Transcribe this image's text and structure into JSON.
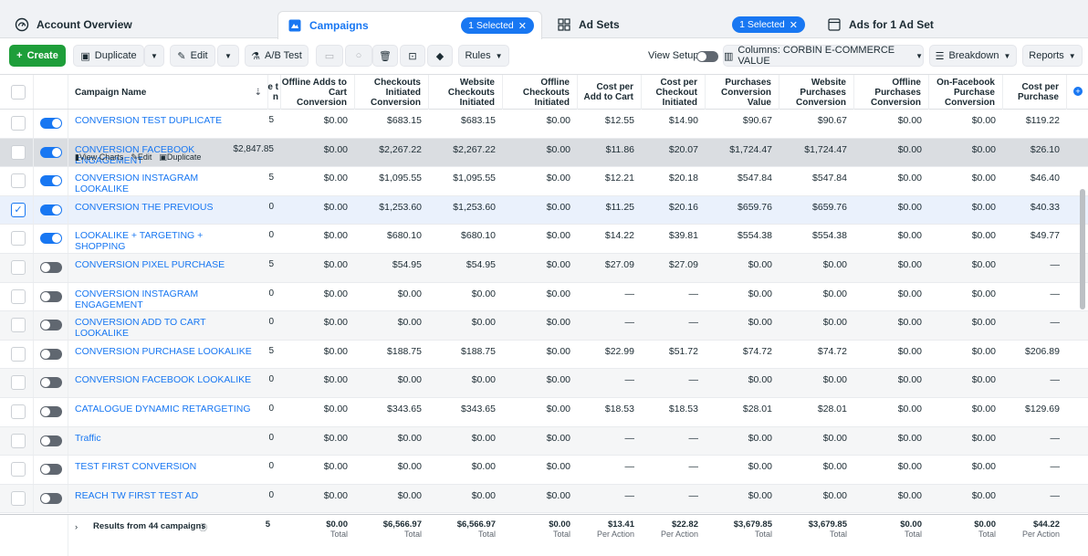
{
  "tabs": {
    "account": {
      "label": "Account Overview"
    },
    "campaigns": {
      "label": "Campaigns",
      "pill": "1 Selected"
    },
    "adsets": {
      "label": "Ad Sets",
      "pill": "1 Selected"
    },
    "ads": {
      "label": "Ads for 1 Ad Set"
    }
  },
  "toolbar": {
    "create": "Create",
    "duplicate": "Duplicate",
    "edit": "Edit",
    "ab_test": "A/B Test",
    "rules": "Rules",
    "view_setup": "View Setup",
    "columns": "Columns: CORBIN E-COMMERCE VALUE",
    "breakdown": "Breakdown",
    "reports": "Reports"
  },
  "headers": {
    "name": "Campaign Name",
    "partial": "e t n",
    "c1": "Offline Adds to Cart Conversion",
    "c2": "Checkouts Initiated Conversion",
    "c3": "Website Checkouts Initiated",
    "c4": "Offline Checkouts Initiated",
    "c5": "Cost per Add to Cart",
    "c6": "Cost per Checkout Initiated",
    "c7": "Purchases Conversion Value",
    "c8": "Website Purchases Conversion",
    "c9": "Offline Purchases Conversion",
    "c10": "On-Facebook Purchase Conversion",
    "c11": "Cost per Purchase"
  },
  "row_actions": {
    "charts": "View Charts",
    "edit": "Edit",
    "duplicate": "Duplicate"
  },
  "rows": [
    {
      "name": "CONVERSION TEST DUPLICATE",
      "p": "5",
      "v": [
        "$0.00",
        "$683.15",
        "$683.15",
        "$0.00",
        "$12.55",
        "$14.90",
        "$90.67",
        "$90.67",
        "$0.00",
        "$0.00",
        "$119.22"
      ]
    },
    {
      "name": "CONVERSION FACEBOOK ENGAGEMENT",
      "p": "$2,847.85",
      "v": [
        "$0.00",
        "$2,267.22",
        "$2,267.22",
        "$0.00",
        "$11.86",
        "$20.07",
        "$1,724.47",
        "$1,724.47",
        "$0.00",
        "$0.00",
        "$26.10"
      ]
    },
    {
      "name": "CONVERSION INSTAGRAM LOOKALIKE",
      "p": "5",
      "v": [
        "$0.00",
        "$1,095.55",
        "$1,095.55",
        "$0.00",
        "$12.21",
        "$20.18",
        "$547.84",
        "$547.84",
        "$0.00",
        "$0.00",
        "$46.40"
      ]
    },
    {
      "name": "CONVERSION THE PREVIOUS",
      "p": "0",
      "v": [
        "$0.00",
        "$1,253.60",
        "$1,253.60",
        "$0.00",
        "$11.25",
        "$20.16",
        "$659.76",
        "$659.76",
        "$0.00",
        "$0.00",
        "$40.33"
      ]
    },
    {
      "name": "LOOKALIKE + TARGETING + SHOPPING",
      "p": "0",
      "v": [
        "$0.00",
        "$680.10",
        "$680.10",
        "$0.00",
        "$14.22",
        "$39.81",
        "$554.38",
        "$554.38",
        "$0.00",
        "$0.00",
        "$49.77"
      ]
    },
    {
      "name": "CONVERSION PIXEL PURCHASE",
      "p": "5",
      "v": [
        "$0.00",
        "$54.95",
        "$54.95",
        "$0.00",
        "$27.09",
        "$27.09",
        "$0.00",
        "$0.00",
        "$0.00",
        "$0.00",
        "—"
      ]
    },
    {
      "name": "CONVERSION INSTAGRAM ENGAGEMENT",
      "p": "0",
      "v": [
        "$0.00",
        "$0.00",
        "$0.00",
        "$0.00",
        "—",
        "—",
        "$0.00",
        "$0.00",
        "$0.00",
        "$0.00",
        "—"
      ]
    },
    {
      "name": "CONVERSION ADD TO CART LOOKALIKE",
      "p": "0",
      "v": [
        "$0.00",
        "$0.00",
        "$0.00",
        "$0.00",
        "—",
        "—",
        "$0.00",
        "$0.00",
        "$0.00",
        "$0.00",
        "—"
      ]
    },
    {
      "name": "CONVERSION PURCHASE LOOKALIKE",
      "p": "5",
      "v": [
        "$0.00",
        "$188.75",
        "$188.75",
        "$0.00",
        "$22.99",
        "$51.72",
        "$74.72",
        "$74.72",
        "$0.00",
        "$0.00",
        "$206.89"
      ]
    },
    {
      "name": "CONVERSION FACEBOOK LOOKALIKE",
      "p": "0",
      "v": [
        "$0.00",
        "$0.00",
        "$0.00",
        "$0.00",
        "—",
        "—",
        "$0.00",
        "$0.00",
        "$0.00",
        "$0.00",
        "—"
      ]
    },
    {
      "name": "CATALOGUE DYNAMIC RETARGETING",
      "p": "0",
      "v": [
        "$0.00",
        "$343.65",
        "$343.65",
        "$0.00",
        "$18.53",
        "$18.53",
        "$28.01",
        "$28.01",
        "$0.00",
        "$0.00",
        "$129.69"
      ]
    },
    {
      "name": "Traffic",
      "p": "0",
      "v": [
        "$0.00",
        "$0.00",
        "$0.00",
        "$0.00",
        "—",
        "—",
        "$0.00",
        "$0.00",
        "$0.00",
        "$0.00",
        "—"
      ]
    },
    {
      "name": "TEST FIRST CONVERSION",
      "p": "0",
      "v": [
        "$0.00",
        "$0.00",
        "$0.00",
        "$0.00",
        "—",
        "—",
        "$0.00",
        "$0.00",
        "$0.00",
        "$0.00",
        "—"
      ]
    },
    {
      "name": "REACH TW FIRST TEST AD",
      "p": "0",
      "v": [
        "$0.00",
        "$0.00",
        "$0.00",
        "$0.00",
        "—",
        "—",
        "$0.00",
        "$0.00",
        "$0.00",
        "$0.00",
        "—"
      ]
    }
  ],
  "footer": {
    "label": "Results from 44 campaigns",
    "p": "5",
    "totals": [
      "$0.00",
      "$6,566.97",
      "$6,566.97",
      "$0.00",
      "$13.41",
      "$22.82",
      "$3,679.85",
      "$3,679.85",
      "$0.00",
      "$0.00",
      "$44.22"
    ],
    "subs": [
      "Total",
      "Total",
      "Total",
      "Total",
      "Per Action",
      "Per Action",
      "Total",
      "Total",
      "Total",
      "Total",
      "Per Action"
    ]
  },
  "colors": {
    "accent": "#1877f2",
    "create": "#1e9e3a"
  }
}
